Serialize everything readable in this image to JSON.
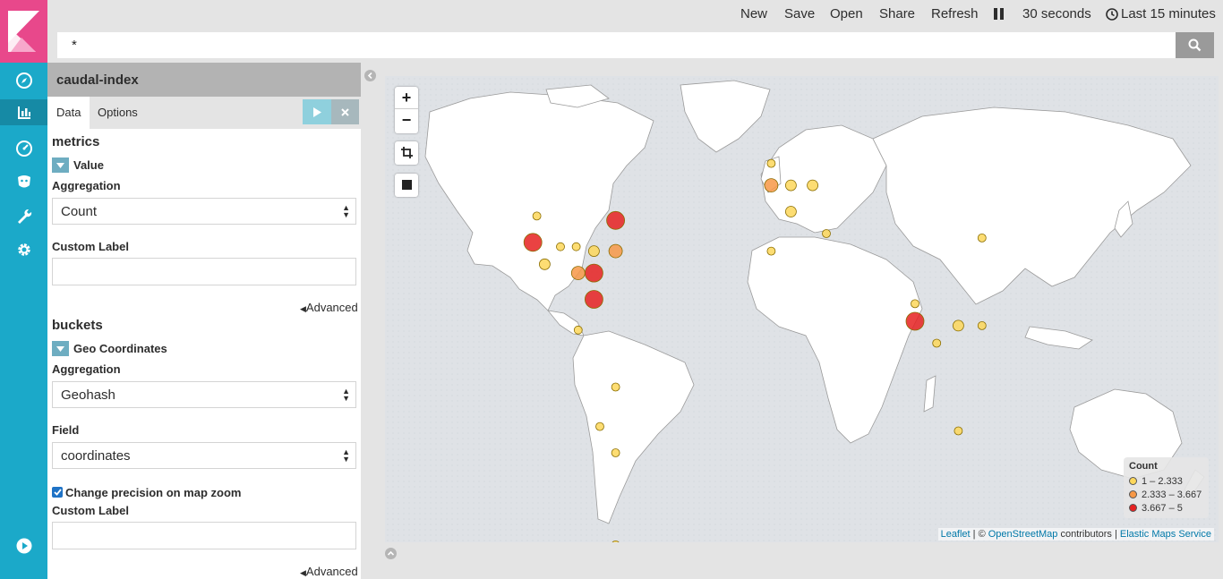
{
  "app": {
    "title": "caudal-index"
  },
  "topbar": {
    "new_label": "New",
    "save_label": "Save",
    "open_label": "Open",
    "share_label": "Share",
    "refresh_label": "Refresh",
    "interval_label": "30 seconds",
    "timerange_label": "Last 15 minutes"
  },
  "search": {
    "value": "*"
  },
  "tabs": {
    "data_label": "Data",
    "options_label": "Options"
  },
  "metrics": {
    "section_title": "metrics",
    "agg_name": "Value",
    "aggregation_label": "Aggregation",
    "aggregation_value": "Count",
    "custom_label_label": "Custom Label",
    "advanced_label": "Advanced"
  },
  "buckets": {
    "section_title": "buckets",
    "agg_name": "Geo Coordinates",
    "aggregation_label": "Aggregation",
    "aggregation_value": "Geohash",
    "field_label": "Field",
    "field_value": "coordinates",
    "precision_label": "Change precision on map zoom",
    "precision_checked": true,
    "custom_label_label": "Custom Label",
    "advanced_label": "Advanced"
  },
  "map": {
    "zoom_in": "+",
    "zoom_out": "−",
    "legend": {
      "title": "Count",
      "ranges": [
        {
          "label": "1 – 2.333",
          "color": "#fdd75b"
        },
        {
          "label": "2.333 – 3.667",
          "color": "#f79847"
        },
        {
          "label": "3.667 – 5",
          "color": "#e62121"
        }
      ]
    },
    "attribution": {
      "leaflet": "Leaflet",
      "separator1": " | © ",
      "osm": "OpenStreetMap",
      "contributors": " contributors | ",
      "ems": "Elastic Maps Service"
    },
    "markers": [
      {
        "lon": -124,
        "lat": 38,
        "count": 5
      },
      {
        "lon": -122,
        "lat": 44,
        "count": 1
      },
      {
        "lon": -118,
        "lat": 33,
        "count": 2
      },
      {
        "lon": -110,
        "lat": 37,
        "count": 1
      },
      {
        "lon": -102,
        "lat": 37,
        "count": 1
      },
      {
        "lon": -101,
        "lat": 31,
        "count": 3
      },
      {
        "lon": -93,
        "lat": 36,
        "count": 2
      },
      {
        "lon": -93,
        "lat": 31,
        "count": 5
      },
      {
        "lon": -93,
        "lat": 25,
        "count": 5
      },
      {
        "lon": -82,
        "lat": 43,
        "count": 5
      },
      {
        "lon": -82,
        "lat": 36,
        "count": 3
      },
      {
        "lon": -101,
        "lat": 18,
        "count": 1
      },
      {
        "lon": -82,
        "lat": 5,
        "count": 1
      },
      {
        "lon": -90,
        "lat": -4,
        "count": 1
      },
      {
        "lon": -82,
        "lat": -10,
        "count": 1
      },
      {
        "lon": -82,
        "lat": -31,
        "count": 1
      },
      {
        "lon": -3,
        "lat": 56,
        "count": 1
      },
      {
        "lon": -3,
        "lat": 51,
        "count": 3
      },
      {
        "lon": 7,
        "lat": 51,
        "count": 2
      },
      {
        "lon": 18,
        "lat": 51,
        "count": 2
      },
      {
        "lon": 7,
        "lat": 45,
        "count": 2
      },
      {
        "lon": 25,
        "lat": 40,
        "count": 1
      },
      {
        "lon": -3,
        "lat": 36,
        "count": 1
      },
      {
        "lon": 70,
        "lat": 24,
        "count": 1
      },
      {
        "lon": 70,
        "lat": 20,
        "count": 5
      },
      {
        "lon": 81,
        "lat": 15,
        "count": 1
      },
      {
        "lon": 92,
        "lat": 19,
        "count": 2
      },
      {
        "lon": 104,
        "lat": 19,
        "count": 1
      },
      {
        "lon": 104,
        "lat": 39,
        "count": 1
      },
      {
        "lon": 92,
        "lat": -5,
        "count": 1
      }
    ]
  }
}
